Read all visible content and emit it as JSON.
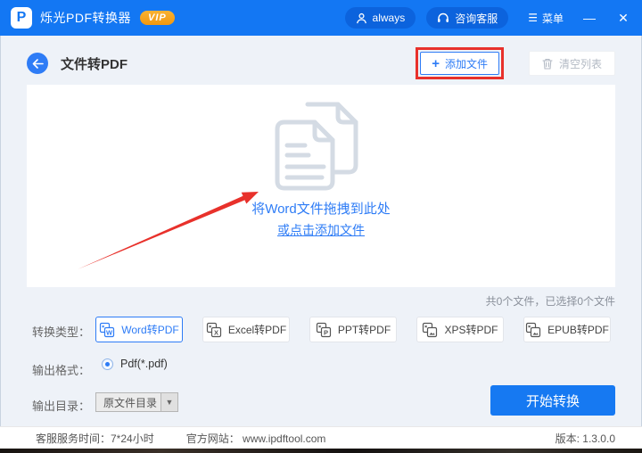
{
  "titlebar": {
    "app_name": "烁光PDF转换器",
    "vip_label": "VIP",
    "user_label": "always",
    "service_label": "咨询客服",
    "menu_label": "菜单",
    "minimize_glyph": "—",
    "close_glyph": "✕"
  },
  "header": {
    "title": "文件转PDF",
    "add_button": "添加文件",
    "add_plus": "+",
    "clear_button": "清空列表"
  },
  "dropzone": {
    "line1": "将Word文件拖拽到此处",
    "line2": "或点击添加文件"
  },
  "status": {
    "files_summary": "共0个文件，已选择0个文件"
  },
  "convert_types": {
    "label": "转换类型：",
    "items": [
      {
        "label": "Word转PDF",
        "letter": "W",
        "active": true
      },
      {
        "label": "Excel转PDF",
        "letter": "X",
        "active": false
      },
      {
        "label": "PPT转PDF",
        "letter": "P",
        "active": false
      },
      {
        "label": "XPS转PDF",
        "letter": "",
        "active": false
      },
      {
        "label": "EPUB转PDF",
        "letter": "",
        "active": false
      }
    ]
  },
  "output_format": {
    "label": "输出格式：",
    "option": "Pdf(*.pdf)"
  },
  "output_dir": {
    "label": "输出目录：",
    "value": "原文件目录",
    "arrow": "▼"
  },
  "start_button": "开始转换",
  "footer": {
    "service_time": "客服服务时间：7*24小时",
    "website": "官方网站：  www.ipdftool.com",
    "version": "版本: 1.3.0.0"
  },
  "colors": {
    "titlebar": "#1377f3",
    "accent": "#2e7cf6",
    "annotation_red": "#e8312b",
    "vip_orange": "#f2980f"
  }
}
